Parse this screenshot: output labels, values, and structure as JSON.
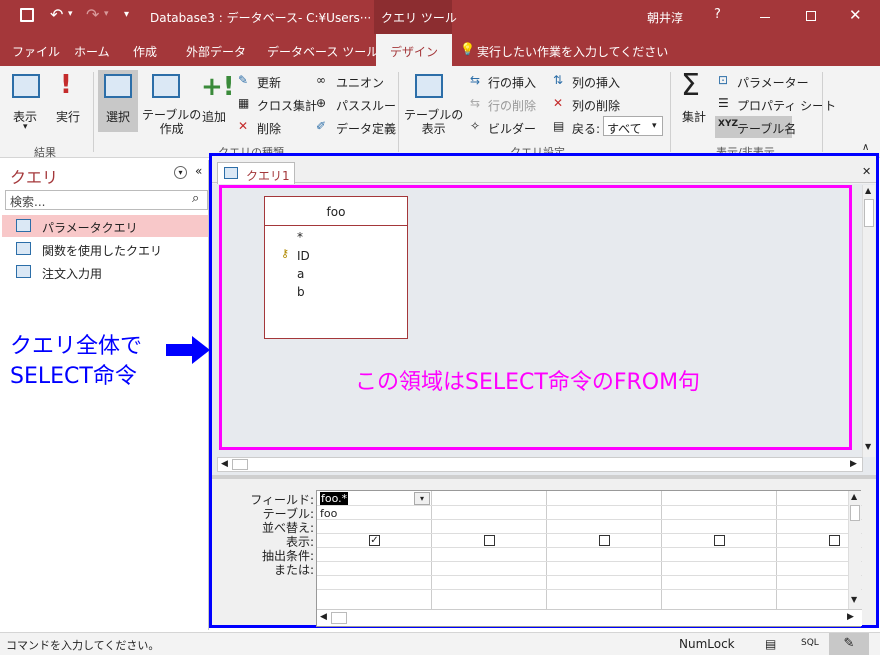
{
  "titlebar": {
    "title": "Database3 : データベース- C:¥Users···",
    "context_tab": "クエリ ツール",
    "user": "朝井淳",
    "help": "?"
  },
  "ribbon_tabs": [
    "ファイル",
    "ホーム",
    "作成",
    "外部データ",
    "データベース ツール",
    "デザイン"
  ],
  "tell_me": "実行したい作業を入力してください",
  "ribbon": {
    "results": {
      "view": "表示",
      "run": "実行",
      "label": "結果"
    },
    "query_type": {
      "select": "選択",
      "make_table": "テーブルの\n作成",
      "append": "追加",
      "update": "更新",
      "crosstab": "クロス集計",
      "delete": "削除",
      "union": "ユニオン",
      "passthrough": "パススルー",
      "data_definition": "データ定義",
      "label": "クエリの種類"
    },
    "query_setup": {
      "show_table": "テーブルの\n表示",
      "insert_rows": "行の挿入",
      "delete_rows": "行の削除",
      "builder": "ビルダー",
      "insert_columns": "列の挿入",
      "delete_columns": "列の削除",
      "return_label": "戻る:",
      "return_value": "すべて",
      "label": "クエリ設定"
    },
    "show_hide": {
      "totals": "集計",
      "parameters": "パラメーター",
      "property_sheet": "プロパティ シート",
      "table_names": "テーブル名",
      "label": "表示/非表示"
    }
  },
  "nav": {
    "title": "クエリ",
    "search_placeholder": "検索...",
    "items": [
      "パラメータクエリ",
      "関数を使用したクエリ",
      "注文入力用"
    ]
  },
  "document": {
    "tab": "クエリ1",
    "table": {
      "name": "foo",
      "fields": [
        "*",
        "ID",
        "a",
        "b"
      ]
    },
    "grid": {
      "row_labels": [
        "フィールド:",
        "テーブル:",
        "並べ替え:",
        "表示:",
        "抽出条件:",
        "または:"
      ],
      "field": "foo.*",
      "table": "foo",
      "show": [
        true,
        false,
        false,
        false,
        false
      ]
    }
  },
  "annotations": {
    "whole_query_line1": "クエリ全体で",
    "whole_query_line2": "SELECT命令",
    "from_clause": "この領域はSELECT命令のFROM句"
  },
  "statusbar": {
    "message": "コマンドを入力してください。",
    "numlock": "NumLock",
    "sql": "SQL"
  },
  "colors": {
    "accent": "#a4373a",
    "annotation_blue": "#0000ff",
    "annotation_magenta": "#ff00ff",
    "table_border": "#a4373a"
  }
}
